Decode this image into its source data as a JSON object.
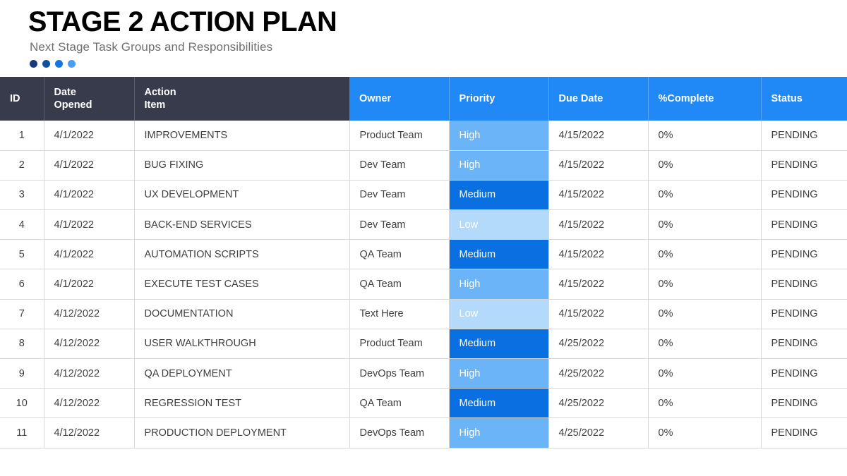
{
  "header": {
    "title": "STAGE 2 ACTION PLAN",
    "subtitle": "Next Stage Task Groups and Responsibilities",
    "dots": [
      {
        "name": "dot-1",
        "color": "#18387C"
      },
      {
        "name": "dot-2",
        "color": "#10519E"
      },
      {
        "name": "dot-3",
        "color": "#1476E0"
      },
      {
        "name": "dot-4",
        "color": "#4B9CF3"
      }
    ]
  },
  "table": {
    "columns": [
      {
        "key": "id",
        "label": "ID",
        "style": "dark"
      },
      {
        "key": "date",
        "label": "Date\nOpened",
        "style": "dark"
      },
      {
        "key": "action",
        "label": "Action\nItem",
        "style": "dark"
      },
      {
        "key": "owner",
        "label": "Owner",
        "style": "blue"
      },
      {
        "key": "priority",
        "label": "Priority",
        "style": "blue"
      },
      {
        "key": "due",
        "label": "Due Date",
        "style": "blue"
      },
      {
        "key": "pct",
        "label": "%Complete",
        "style": "blue"
      },
      {
        "key": "status",
        "label": "Status",
        "style": "blue"
      }
    ],
    "priority_colors": {
      "High": "#6CB4F8",
      "Medium": "#0A6FE0",
      "Low": "#B3D9FB"
    },
    "header_colors": {
      "dark": "#383B4C",
      "blue": "#2189F5"
    },
    "rows": [
      {
        "id": "1",
        "date": "4/1/2022",
        "action": "IMPROVEMENTS",
        "owner": "Product Team",
        "priority": "High",
        "due": "4/15/2022",
        "pct": "0%",
        "status": "PENDING"
      },
      {
        "id": "2",
        "date": "4/1/2022",
        "action": "BUG FIXING",
        "owner": "Dev Team",
        "priority": "High",
        "due": "4/15/2022",
        "pct": "0%",
        "status": "PENDING"
      },
      {
        "id": "3",
        "date": "4/1/2022",
        "action": "UX DEVELOPMENT",
        "owner": "Dev Team",
        "priority": "Medium",
        "due": "4/15/2022",
        "pct": "0%",
        "status": "PENDING"
      },
      {
        "id": "4",
        "date": "4/1/2022",
        "action": "BACK-END SERVICES",
        "owner": "Dev Team",
        "priority": "Low",
        "due": "4/15/2022",
        "pct": "0%",
        "status": "PENDING"
      },
      {
        "id": "5",
        "date": "4/1/2022",
        "action": "AUTOMATION SCRIPTS",
        "owner": "QA Team",
        "priority": "Medium",
        "due": "4/15/2022",
        "pct": "0%",
        "status": "PENDING"
      },
      {
        "id": "6",
        "date": "4/1/2022",
        "action": "EXECUTE TEST CASES",
        "owner": "QA Team",
        "priority": "High",
        "due": "4/15/2022",
        "pct": "0%",
        "status": "PENDING"
      },
      {
        "id": "7",
        "date": "4/12/2022",
        "action": "DOCUMENTATION",
        "owner": "Text Here",
        "priority": "Low",
        "due": "4/15/2022",
        "pct": "0%",
        "status": "PENDING"
      },
      {
        "id": "8",
        "date": "4/12/2022",
        "action": "USER WALKTHROUGH",
        "owner": "Product Team",
        "priority": "Medium",
        "due": "4/25/2022",
        "pct": "0%",
        "status": "PENDING"
      },
      {
        "id": "9",
        "date": "4/12/2022",
        "action": "QA DEPLOYMENT",
        "owner": "DevOps Team",
        "priority": "High",
        "due": "4/25/2022",
        "pct": "0%",
        "status": "PENDING"
      },
      {
        "id": "10",
        "date": "4/12/2022",
        "action": "REGRESSION TEST",
        "owner": "QA Team",
        "priority": "Medium",
        "due": "4/25/2022",
        "pct": "0%",
        "status": "PENDING"
      },
      {
        "id": "11",
        "date": "4/12/2022",
        "action": "PRODUCTION DEPLOYMENT",
        "owner": "DevOps Team",
        "priority": "High",
        "due": "4/25/2022",
        "pct": "0%",
        "status": "PENDING"
      }
    ]
  }
}
